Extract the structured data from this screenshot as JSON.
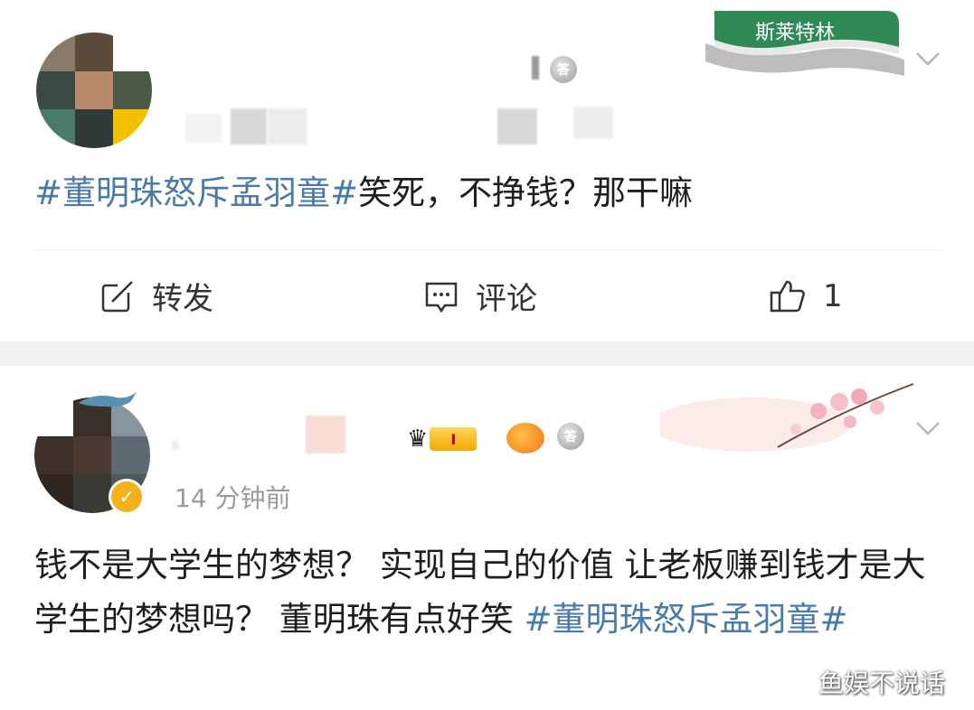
{
  "post1": {
    "content_hashtag": "#董明珠怒斥孟羽童#",
    "content_text": "笑死，不挣钱？那干嘛",
    "actions": {
      "repost_label": "转发",
      "comment_label": "评论",
      "like_count": "1"
    },
    "banner_text": "斯莱特林",
    "medal_text": "答"
  },
  "post2": {
    "timestamp": "14 分钟前",
    "content_text": "钱不是大学生的梦想？ 实现自己的价值 让老板赚到钱才是大学生的梦想吗？ 董明珠有点好笑 ",
    "content_hashtag": "#董明珠怒斥孟羽童#",
    "verified_icon": "v-badge-icon",
    "crown_badge_text": "I",
    "medal_text": "答"
  },
  "watermark": "鱼娱不说话",
  "colors": {
    "hashtag": "#4a7aa8",
    "separator": "#f2f2f2",
    "timestamp": "#9a9a9a",
    "verified": "#f3b21c"
  }
}
